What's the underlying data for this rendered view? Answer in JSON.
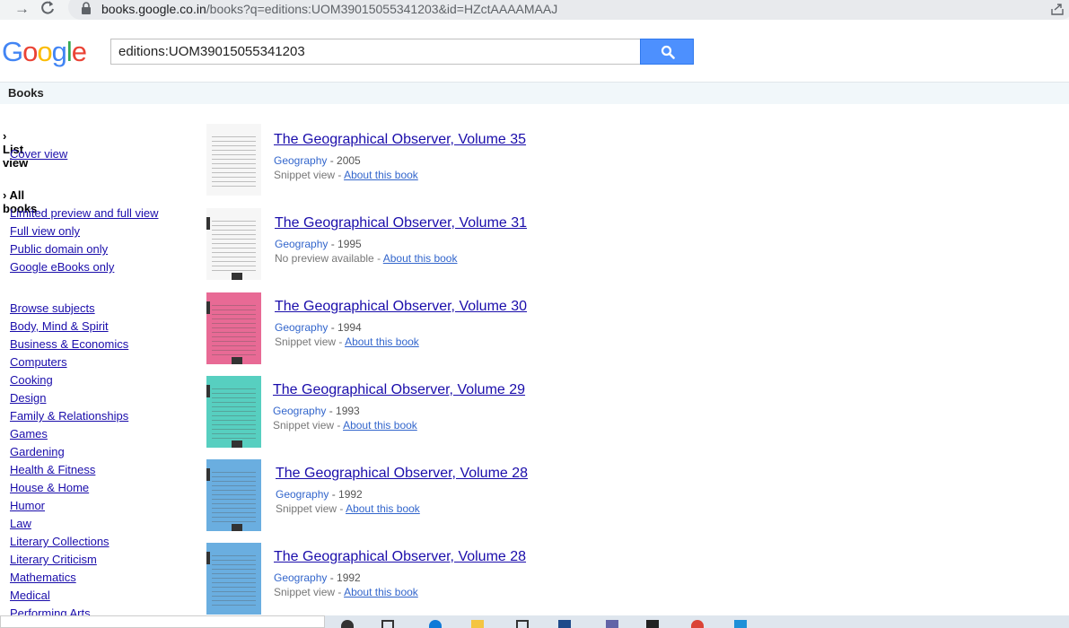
{
  "browser": {
    "url_host": "books.google.co.in",
    "url_path": "/books?q=editions:UOM39015055341203&id=HZctAAAAMAAJ"
  },
  "header": {
    "logo": [
      "G",
      "o",
      "o",
      "g",
      "l",
      "e"
    ],
    "search_value": "editions:UOM39015055341203"
  },
  "books_bar": {
    "label": "Books"
  },
  "sidebar": {
    "view_head": "› List view",
    "cover_view": "Cover view",
    "filter_head": "› All books",
    "filters": [
      "Limited preview and full view",
      "Full view only",
      "Public domain only",
      "Google eBooks only"
    ],
    "subjects": [
      "Browse subjects",
      "Body, Mind & Spirit",
      "Business & Economics",
      "Computers",
      "Cooking",
      "Design",
      "Family & Relationships",
      "Games",
      "Gardening",
      "Health & Fitness",
      "House & Home",
      "Humor",
      "Law",
      "Literary Collections",
      "Literary Criticism",
      "Mathematics",
      "Medical",
      "Performing Arts"
    ]
  },
  "results": [
    {
      "title": "The Geographical Observer, Volume 35",
      "subject": "Geography",
      "year": " - 2005",
      "view": "Snippet view",
      "sep": " - ",
      "about": "About this book",
      "cover": "white"
    },
    {
      "title": "The Geographical Observer, Volume 31",
      "subject": "Geography",
      "year": " - 1995",
      "view": "No preview available",
      "sep": " - ",
      "about": "About this book",
      "cover": "white"
    },
    {
      "title": "The Geographical Observer, Volume 30",
      "subject": "Geography",
      "year": " - 1994",
      "view": "Snippet view",
      "sep": " - ",
      "about": "About this book",
      "cover": "pink"
    },
    {
      "title": "The Geographical Observer, Volume 29",
      "subject": "Geography",
      "year": " - 1993",
      "view": "Snippet view",
      "sep": " - ",
      "about": "About this book",
      "cover": "teal"
    },
    {
      "title": "The Geographical Observer, Volume 28",
      "subject": "Geography",
      "year": " - 1992",
      "view": "Snippet view",
      "sep": " - ",
      "about": "About this book",
      "cover": "blue"
    },
    {
      "title": "The Geographical Observer, Volume 28",
      "subject": "Geography",
      "year": " - 1992",
      "view": "Snippet view",
      "sep": " - ",
      "about": "About this book",
      "cover": "blue"
    }
  ],
  "colors": {
    "link": "#1a0dab",
    "subject": "#3366cc",
    "search_button": "#4d90fe"
  },
  "icons": {
    "forward": "arrow-forward-icon",
    "reload": "reload-icon",
    "lock": "lock-icon",
    "share": "share-icon",
    "search": "magnifier-icon"
  }
}
